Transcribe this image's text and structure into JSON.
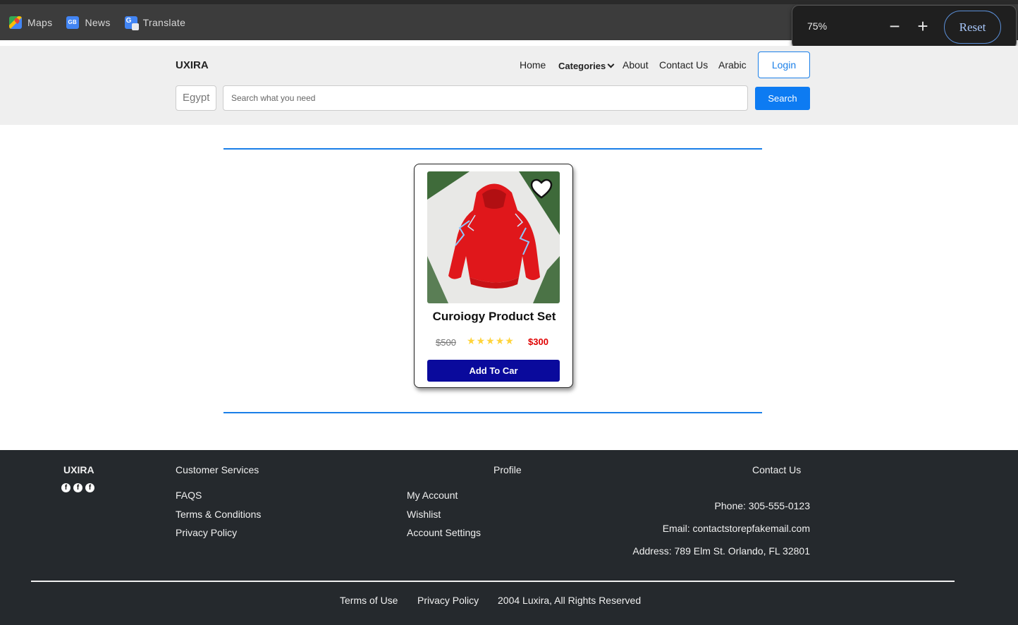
{
  "bookmarks": [
    {
      "label": "Maps",
      "icon": "maps-icon"
    },
    {
      "label": "News",
      "icon": "news-icon"
    },
    {
      "label": "Translate",
      "icon": "translate-icon"
    }
  ],
  "zoom": {
    "level": "75%",
    "minus": "−",
    "plus": "+",
    "reset": "Reset"
  },
  "header": {
    "brand": "UXIRA",
    "nav": {
      "home": "Home",
      "categories": "Categories",
      "about": "About",
      "contact": "Contact Us",
      "language": "Arabic"
    },
    "login": "Login",
    "country": "Egypt",
    "search_placeholder": "Search what you need",
    "search_button": "Search"
  },
  "product": {
    "name": "Curoiogy Product Set",
    "old_price": "$500",
    "new_price": "$300",
    "rating": 5,
    "add_button": "Add To Car"
  },
  "footer": {
    "brand": "UXIRA",
    "social_glyph": "f",
    "customer_services": {
      "heading": "Customer Services",
      "links": [
        "FAQS",
        "Terms & Conditions",
        "Privacy Policy"
      ]
    },
    "profile": {
      "heading": "Profile",
      "links": [
        "My Account",
        "Wishlist",
        "Account Settings"
      ]
    },
    "contact": {
      "heading": "Contact Us",
      "phone": "Phone: 305-555-0123",
      "email": "Email: contactstorepfakemail.com",
      "address": "Address: 789 Elm St. Orlando, FL 32801"
    },
    "bottom": {
      "terms": "Terms of Use",
      "privacy": "Privacy Policy",
      "copyright": "2004 Luxira, All Rights Reserved"
    }
  },
  "colors": {
    "accent": "#0d7bf2",
    "add_button": "#0a0a9c",
    "sale_price": "#e00000",
    "footer_bg": "#25292d",
    "star": "#ffd43b"
  }
}
